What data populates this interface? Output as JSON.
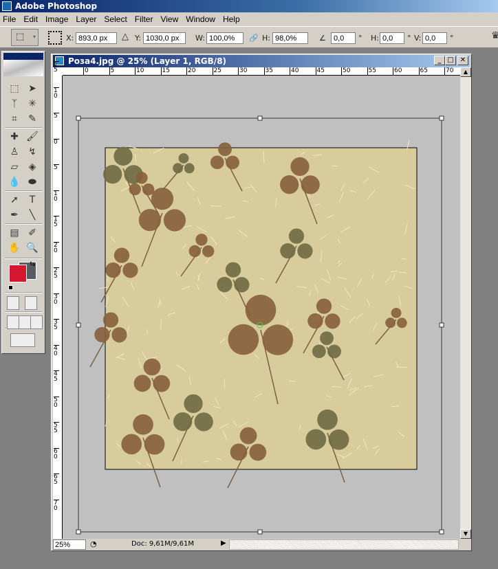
{
  "app": {
    "title": "Adobe Photoshop"
  },
  "menu": [
    "File",
    "Edit",
    "Image",
    "Layer",
    "Select",
    "Filter",
    "View",
    "Window",
    "Help"
  ],
  "options": {
    "x_label": "X:",
    "x": "893,0 px",
    "y_label": "Y:",
    "y": "1030,0 px",
    "w_label": "W:",
    "w": "100,0%",
    "h_label": "H:",
    "h": "98,0%",
    "rot": "0,0",
    "skew_h_label": "H:",
    "skew_h": "0,0",
    "skew_v_label": "V:",
    "skew_v": "0,0",
    "deg": "°"
  },
  "toolbox": {
    "foreground_color": "#d4172e",
    "background_color": "#575c63"
  },
  "document": {
    "title": "Роза4.jpg @ 25% (Layer 1, RGB/8)",
    "zoom": "25%",
    "doc_info": "Doc: 9,61M/9,61M",
    "ruler_h": [
      "0",
      "5",
      "10",
      "15",
      "20",
      "25",
      "30",
      "35",
      "40",
      "45",
      "50",
      "55",
      "60",
      "65",
      "70"
    ],
    "ruler_v": [
      "15",
      "10",
      "5",
      "0",
      "5",
      "10",
      "15",
      "20",
      "25",
      "30",
      "35",
      "40",
      "45",
      "50",
      "55",
      "60",
      "65",
      "70"
    ]
  }
}
